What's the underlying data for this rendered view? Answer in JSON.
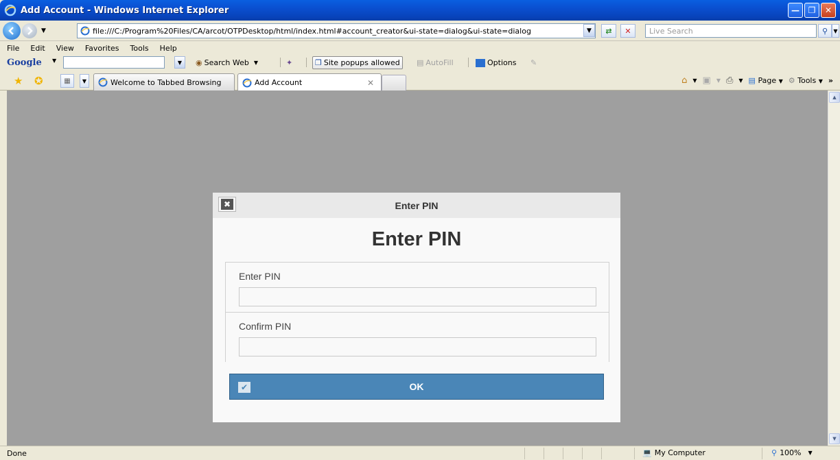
{
  "window": {
    "title": "Add Account - Windows Internet Explorer",
    "minimize_icon": "minimize-icon",
    "maximize_icon": "restore-icon",
    "close_icon": "close-icon"
  },
  "address_bar": {
    "url": "file:///C:/Program%20Files/CA/arcot/OTPDesktop/html/index.html#account_creator&ui-state=dialog&ui-state=dialog",
    "search_placeholder": "Live Search"
  },
  "menu": [
    "File",
    "Edit",
    "View",
    "Favorites",
    "Tools",
    "Help"
  ],
  "google_toolbar": {
    "logo": "Google",
    "search_web": "Search Web",
    "popups": "Site popups allowed",
    "autofill": "AutoFill",
    "options": "Options"
  },
  "tabs": [
    {
      "label": "Welcome to Tabbed Browsing",
      "active": false
    },
    {
      "label": "Add Account",
      "active": true
    }
  ],
  "command_bar": {
    "page": "Page",
    "tools": "Tools"
  },
  "dialog": {
    "header_title": "Enter PIN",
    "heading": "Enter PIN",
    "fields": [
      {
        "label": "Enter PIN",
        "value": ""
      },
      {
        "label": "Confirm PIN",
        "value": ""
      }
    ],
    "ok_label": "OK"
  },
  "status_bar": {
    "text": "Done",
    "zone": "My Computer",
    "zoom": "100%"
  },
  "colors": {
    "ok_button": "#4a86b7",
    "page_background": "#9f9f9f",
    "titlebar": "#0a4fd0"
  }
}
